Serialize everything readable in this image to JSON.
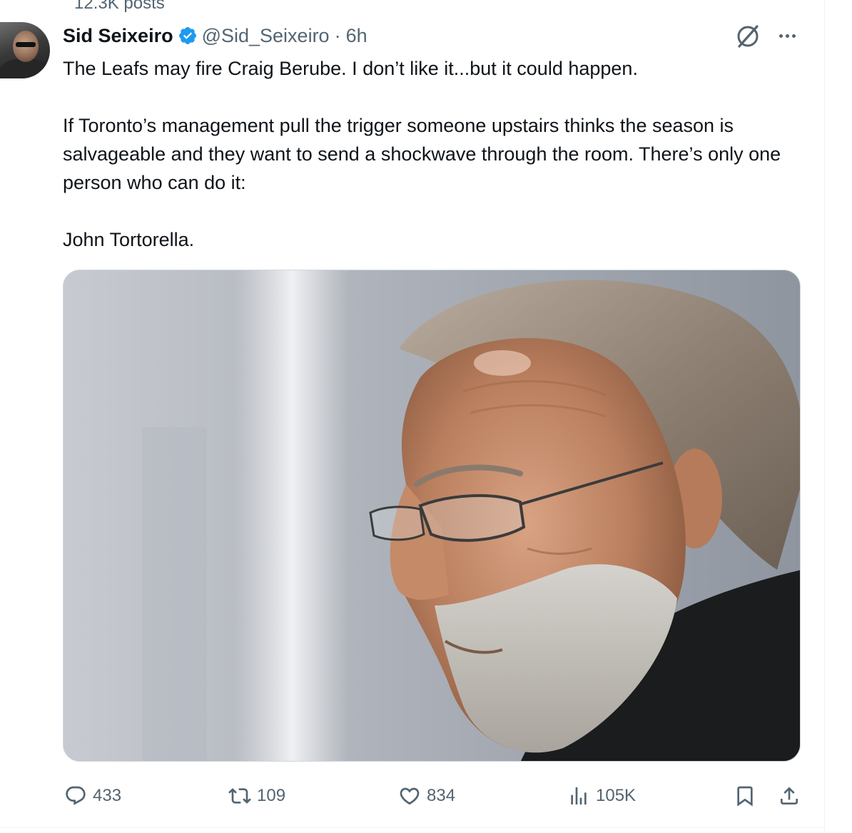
{
  "profile_header": {
    "posts_count": "12.3K posts"
  },
  "tweet": {
    "author_name": "Sid Seixeiro",
    "handle": "@Sid_Seixeiro",
    "separator": "·",
    "time": "6h",
    "text": "The Leafs may fire Craig Berube. I don’t like it...but it could happen.\n\nIf Toronto’s management pull the trigger someone upstairs thinks the season is salvageable and they want to send a shockwave through the room. There’s only one person who can do it:\n\nJohn Tortorella."
  },
  "actions": {
    "replies": "433",
    "reposts": "109",
    "likes": "834",
    "views": "105K"
  },
  "colors": {
    "text_primary": "#0f1419",
    "text_secondary": "#536471",
    "verified_blue": "#1d9bf0",
    "border": "#cfd9de"
  },
  "icons": [
    "grok-icon",
    "more-icon",
    "verified-badge-icon",
    "reply-icon",
    "retweet-icon",
    "like-icon",
    "views-icon",
    "bookmark-icon",
    "share-icon"
  ]
}
